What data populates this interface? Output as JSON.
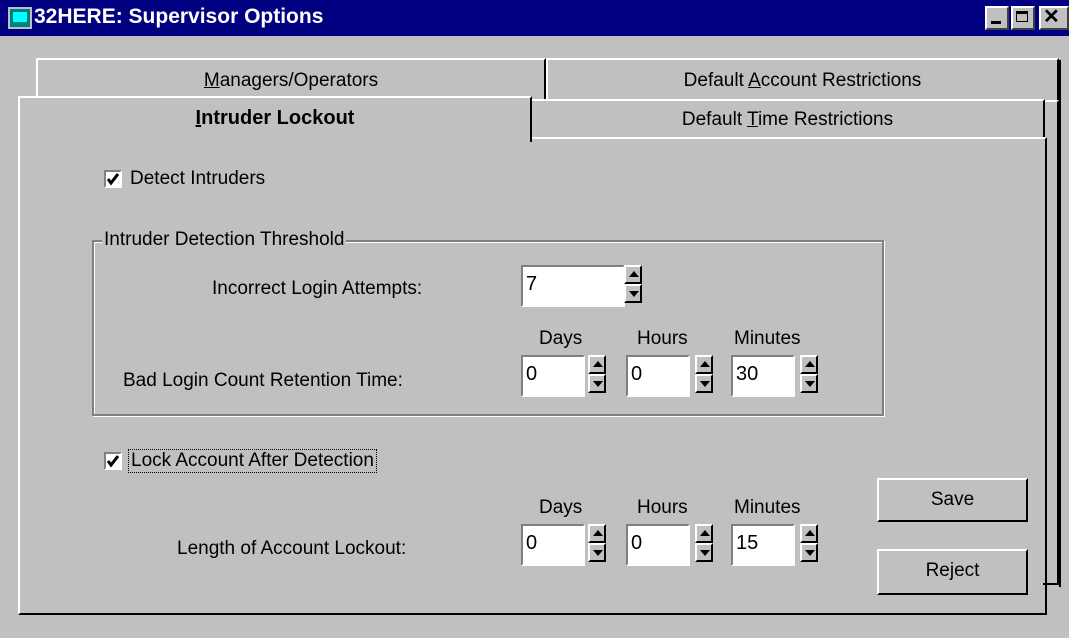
{
  "window": {
    "title": "32HERE: Supervisor Options",
    "controls": [
      "minimize",
      "maximize",
      "close"
    ]
  },
  "tabs": {
    "back_row": [
      {
        "label": "Managers/Operators",
        "mnemonic": "M"
      },
      {
        "label": "Default Account Restrictions",
        "mnemonic": "A"
      }
    ],
    "front_row": [
      {
        "label": "Intruder Lockout",
        "mnemonic": "I",
        "active": true
      },
      {
        "label": "Default Time Restrictions",
        "mnemonic": "T"
      }
    ]
  },
  "detect_intruders": {
    "label": "Detect Intruders",
    "checked": true
  },
  "threshold_group": {
    "title": "Intruder Detection Threshold",
    "attempts_label": "Incorrect Login Attempts:",
    "attempts_value": "7",
    "retention_label": "Bad Login Count Retention Time:",
    "days_header": "Days",
    "hours_header": "Hours",
    "minutes_header": "Minutes",
    "days_value": "0",
    "hours_value": "0",
    "minutes_value": "30"
  },
  "lock_account": {
    "label": "Lock Account After Detection",
    "checked": true
  },
  "lockout": {
    "label": "Length of Account Lockout:",
    "days_header": "Days",
    "hours_header": "Hours",
    "minutes_header": "Minutes",
    "days_value": "0",
    "hours_value": "0",
    "minutes_value": "15"
  },
  "buttons": {
    "save": "Save",
    "reject": "Reject"
  }
}
